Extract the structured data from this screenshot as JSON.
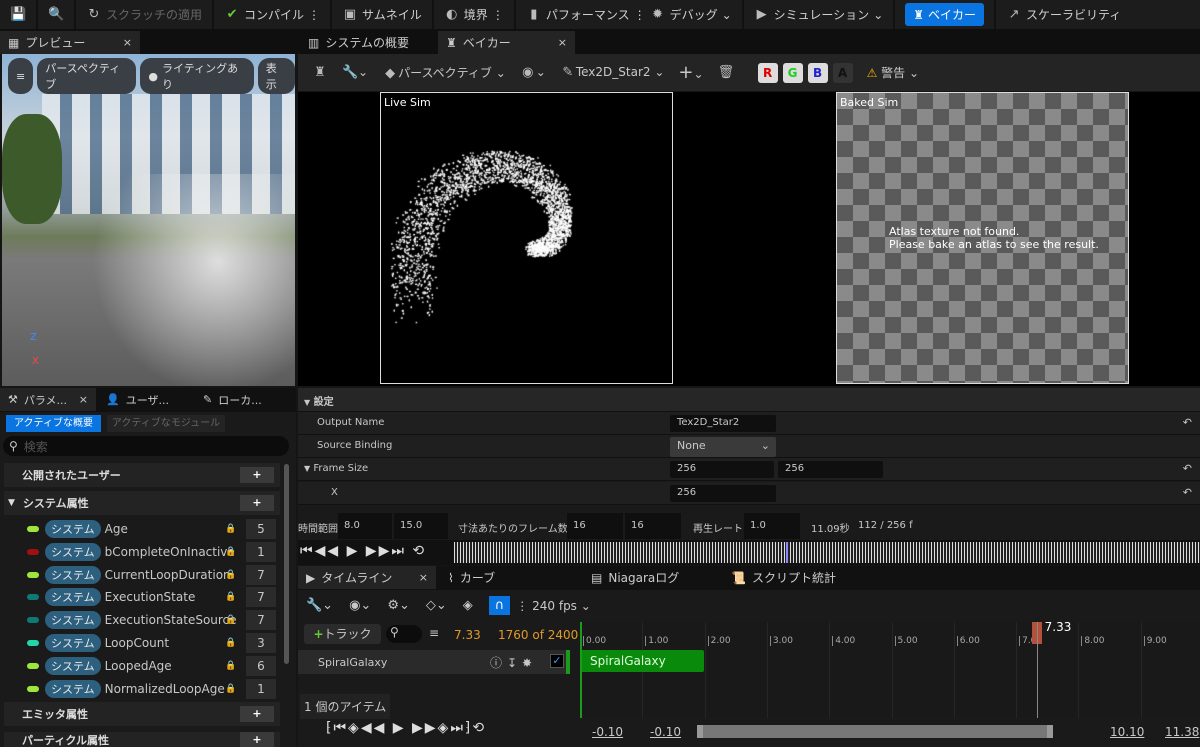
{
  "toolbar": {
    "save_icon": "save-icon",
    "browse_icon": "browse-icon",
    "apply_scratch": "スクラッチの適用",
    "compile": "コンパイル",
    "thumbnail": "サムネイル",
    "bounds": "境界",
    "performance": "パフォーマンス",
    "debug": "デバッグ",
    "simulation": "シミュレーション",
    "baker": "ベイカー",
    "scalability": "スケーラビリティ",
    "accent": "#0a74e0"
  },
  "tabs": {
    "preview": "プレビュー",
    "system_overview": "システムの概要",
    "baker": "ベイカー"
  },
  "preview": {
    "menu": "≡",
    "perspective": "パースペクティブ",
    "lighting": "ライティングあり",
    "show": "表示",
    "axis_z": "Z",
    "axis_x": "X"
  },
  "baker_toolbar": {
    "perspective": "パースペクティブ",
    "output": "Tex2D_Star2",
    "r": "R",
    "g": "G",
    "b": "B",
    "a": "A",
    "warning": "警告"
  },
  "viewport": {
    "live_label": "Live Sim",
    "baked_label": "Baked Sim",
    "baked_msg1": "Atlas texture not found.",
    "baked_msg2": "Please bake an atlas to see the result."
  },
  "left_panel": {
    "tabs": [
      "パラメ...",
      "ユーザ...",
      "ローカ..."
    ],
    "btn_active_overview": "アクティブな概要",
    "btn_active_modules": "アクティブなモジュール",
    "search_placeholder": "検索",
    "sections": {
      "user": "公開されたユーザー",
      "system": "システム属性",
      "emitter": "エミッタ属性",
      "particle": "パーティクル属性"
    },
    "badge": "システム",
    "items": [
      {
        "name": "Age",
        "count": "5",
        "color": "#9ee63a"
      },
      {
        "name": "bCompleteOnInactive",
        "count": "1",
        "color": "#a01010"
      },
      {
        "name": "CurrentLoopDuration",
        "count": "7",
        "color": "#9ee63a"
      },
      {
        "name": "ExecutionState",
        "count": "7",
        "color": "#0d7a74"
      },
      {
        "name": "ExecutionStateSource",
        "count": "7",
        "color": "#0d7a74"
      },
      {
        "name": "LoopCount",
        "count": "3",
        "color": "#22d6a8"
      },
      {
        "name": "LoopedAge",
        "count": "6",
        "color": "#9ee63a"
      },
      {
        "name": "NormalizedLoopAge",
        "count": "1",
        "color": "#9ee63a"
      }
    ]
  },
  "settings": {
    "header": "設定",
    "output_name_label": "Output Name",
    "output_name": "Tex2D_Star2",
    "source_binding_label": "Source Binding",
    "source_binding": "None",
    "frame_size_label": "Frame Size",
    "frame_w": "256",
    "frame_h": "256",
    "x_label": "X",
    "x": "256"
  },
  "timing": {
    "range_label": "時間範囲",
    "range_start": "8.0",
    "range_end": "15.0",
    "frames_label": "寸法あたりのフレーム数",
    "frames_x": "16",
    "frames_y": "16",
    "rate_label": "再生レート",
    "rate": "1.0",
    "time": "11.09秒",
    "frame": "112 / 256 f"
  },
  "timeline": {
    "tabs": [
      "タイムライン",
      "カーブ",
      "Niagaraログ",
      "スクリプト統計"
    ],
    "fps": "240 fps",
    "add_track": "トラック",
    "current_time": "7.33",
    "frame_count": "1760 of 2400",
    "track": "SpiralGalaxy",
    "clip": "SpiralGalaxy",
    "ticks": [
      "0.00",
      "1.00",
      "2.00",
      "3.00",
      "4.00",
      "5.00",
      "6.00",
      "7.00",
      "8.00",
      "9.00"
    ],
    "playhead": "7.33",
    "playhead_value": 7.33,
    "items_count": "1 個のアイテム",
    "view_start": "-0.10",
    "view_start2": "-0.10",
    "view_end": "10.10",
    "view_end2": "11.38"
  }
}
